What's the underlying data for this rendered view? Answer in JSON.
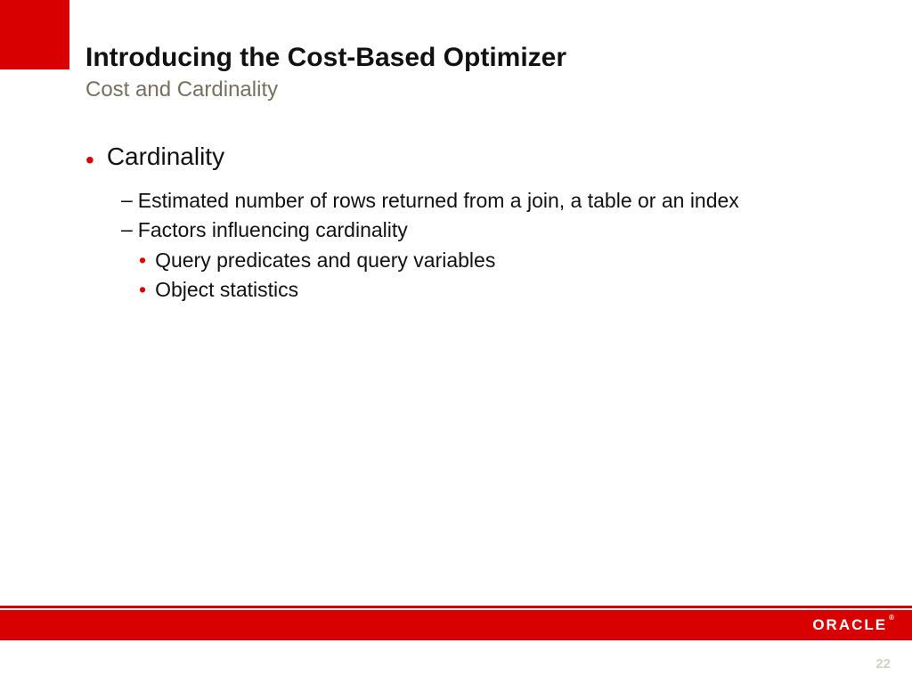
{
  "accent_color": "#d80000",
  "header": {
    "title": "Introducing the Cost-Based Optimizer",
    "subtitle": "Cost and Cardinality"
  },
  "body": {
    "lvl1": "Cardinality",
    "lvl2_a": "Estimated number of rows returned from a join, a table or an index",
    "lvl2_b": "Factors influencing cardinality",
    "lvl3_a": "Query predicates and query variables",
    "lvl3_b": "Object statistics"
  },
  "footer": {
    "logo_text": "ORACLE",
    "registered": "®",
    "page_number": "22"
  }
}
